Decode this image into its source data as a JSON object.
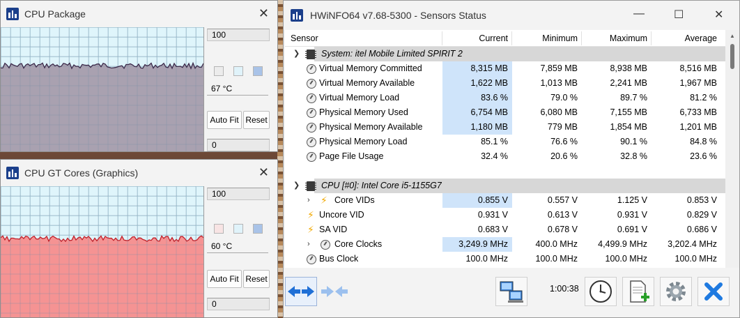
{
  "cpu_package": {
    "title": "CPU Package",
    "max_value": "100",
    "temp": "67 °C",
    "min_value": "0",
    "auto_fit": "Auto Fit",
    "reset": "Reset",
    "graph_color": "#a9a1b0",
    "line_color": "#3b2a4a"
  },
  "cpu_gt": {
    "title": "CPU GT Cores (Graphics)",
    "max_value": "100",
    "temp": "60 °C",
    "min_value": "0",
    "auto_fit": "Auto Fit",
    "reset": "Reset",
    "graph_color": "#f59393",
    "line_color": "#c0202a"
  },
  "main": {
    "title": "HWiNFO64 v7.68-5300 - Sensors Status",
    "columns": [
      "Sensor",
      "Current",
      "Minimum",
      "Maximum",
      "Average"
    ],
    "group1": "System: itel Mobile Limited SPIRIT 2",
    "rows1": [
      {
        "name": "Virtual Memory Committed",
        "cur": "8,315 MB",
        "min": "7,859 MB",
        "max": "8,938 MB",
        "avg": "8,516 MB"
      },
      {
        "name": "Virtual Memory Available",
        "cur": "1,622 MB",
        "min": "1,013 MB",
        "max": "2,241 MB",
        "avg": "1,967 MB"
      },
      {
        "name": "Virtual Memory Load",
        "cur": "83.6 %",
        "min": "79.0 %",
        "max": "89.7 %",
        "avg": "81.2 %"
      },
      {
        "name": "Physical Memory Used",
        "cur": "6,754 MB",
        "min": "6,080 MB",
        "max": "7,155 MB",
        "avg": "6,733 MB"
      },
      {
        "name": "Physical Memory Available",
        "cur": "1,180 MB",
        "min": "779 MB",
        "max": "1,854 MB",
        "avg": "1,201 MB"
      },
      {
        "name": "Physical Memory Load",
        "cur": "85.1 %",
        "min": "76.6 %",
        "max": "90.1 %",
        "avg": "84.8 %"
      },
      {
        "name": "Page File Usage",
        "cur": "32.4 %",
        "min": "20.6 %",
        "max": "32.8 %",
        "avg": "23.6 %"
      }
    ],
    "group2": "CPU [#0]: Intel Core i5-1155G7",
    "rows2": [
      {
        "name": "Core VIDs",
        "cur": "0.855 V",
        "min": "0.557 V",
        "max": "1.125 V",
        "avg": "0.853 V"
      },
      {
        "name": "Uncore VID",
        "cur": "0.931 V",
        "min": "0.613 V",
        "max": "0.931 V",
        "avg": "0.829 V"
      },
      {
        "name": "SA VID",
        "cur": "0.683 V",
        "min": "0.678 V",
        "max": "0.691 V",
        "avg": "0.686 V"
      },
      {
        "name": "Core Clocks",
        "cur": "3,249.9 MHz",
        "min": "400.0 MHz",
        "max": "4,499.9 MHz",
        "avg": "3,202.4 MHz"
      },
      {
        "name": "Bus Clock",
        "cur": "100.0 MHz",
        "min": "100.0 MHz",
        "max": "100.0 MHz",
        "avg": "100.0 MHz"
      }
    ],
    "timer": "1:00:38"
  }
}
